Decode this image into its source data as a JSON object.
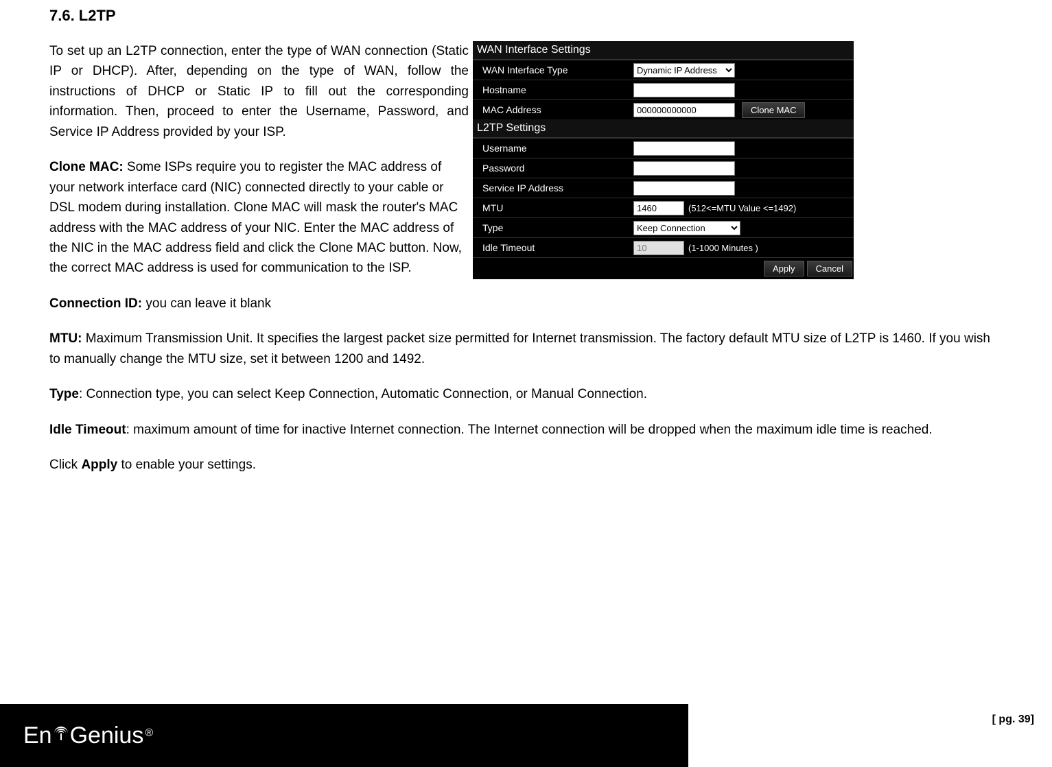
{
  "heading": "7.6.  L2TP",
  "para_intro": "To set up an L2TP connection, enter the type of WAN connection (Static IP or DHCP). After, depending on the type of WAN, follow the instructions of DHCP or Static IP to fill out the corresponding information. Then, proceed to enter the Username, Password, and Service IP Address provided by your ISP.",
  "clone_label": "Clone MAC: ",
  "clone_text": "Some ISPs require you to register the MAC address of your network interface card (NIC) connected directly to your cable or DSL modem during installation. Clone MAC will mask the router's MAC address with the MAC address of your NIC. Enter the MAC address of the NIC in the MAC address field and click the Clone MAC button. Now, the correct MAC address is used for communication to the ISP.",
  "connid_label": "Connection ID: ",
  "connid_text": "you can leave it blank",
  "mtu_label": "MTU: ",
  "mtu_text": "Maximum Transmission Unit. It specifies the largest packet size permitted for Internet transmission. The factory default MTU size of L2TP is 1460. If you wish to manually change the MTU size, set it between 1200 and 1492.",
  "type_label": "Type",
  "type_text": ": Connection type, you can select Keep Connection, Automatic Connection, or Manual Connection.",
  "idle_label": "Idle Timeout",
  "idle_text": ": maximum amount of time for inactive Internet connection. The Internet connection will be dropped when the maximum idle time is reached.",
  "apply_pre": "Click ",
  "apply_bold": "Apply",
  "apply_post": " to enable your settings.",
  "panel": {
    "group1": "WAN Interface Settings",
    "row_iftype": "WAN Interface Type",
    "val_iftype": "Dynamic IP Address",
    "row_host": "Hostname",
    "val_host": "",
    "row_mac": "MAC Address",
    "val_mac": "000000000000",
    "btn_clone": "Clone MAC",
    "group2": "L2TP Settings",
    "row_user": "Username",
    "val_user": "",
    "row_pass": "Password",
    "val_pass": "",
    "row_sip": "Service IP Address",
    "val_sip": "",
    "row_mtu": "MTU",
    "val_mtu": "1460",
    "hint_mtu": "(512<=MTU Value <=1492)",
    "row_ctype": "Type",
    "val_ctype": "Keep Connection",
    "row_idle": "Idle Timeout",
    "val_idle": "10",
    "hint_idle": "(1-1000 Minutes )",
    "btn_apply": "Apply",
    "btn_cancel": "Cancel"
  },
  "logo": {
    "pre": "En",
    "main": "Genius",
    "reg": "®"
  },
  "pgnum": "[ pg. 39]"
}
